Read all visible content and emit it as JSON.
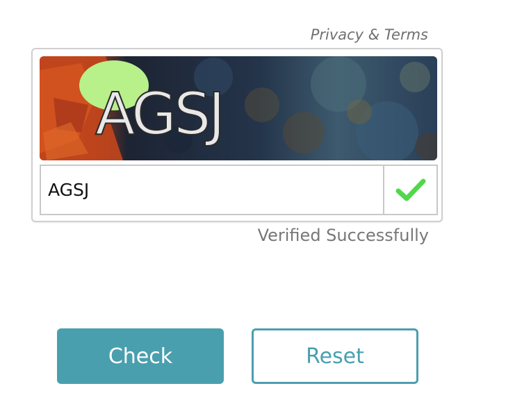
{
  "captcha": {
    "privacy_link": "Privacy & Terms",
    "image_text": "AGSJ",
    "input_value": "AGSJ",
    "status_icon": "checkmark-icon",
    "status_message": "Verified Successfully"
  },
  "actions": {
    "check_label": "Check",
    "reset_label": "Reset"
  },
  "colors": {
    "accent": "#4a9fae",
    "success": "#4fd94a",
    "muted_text": "#777777"
  }
}
